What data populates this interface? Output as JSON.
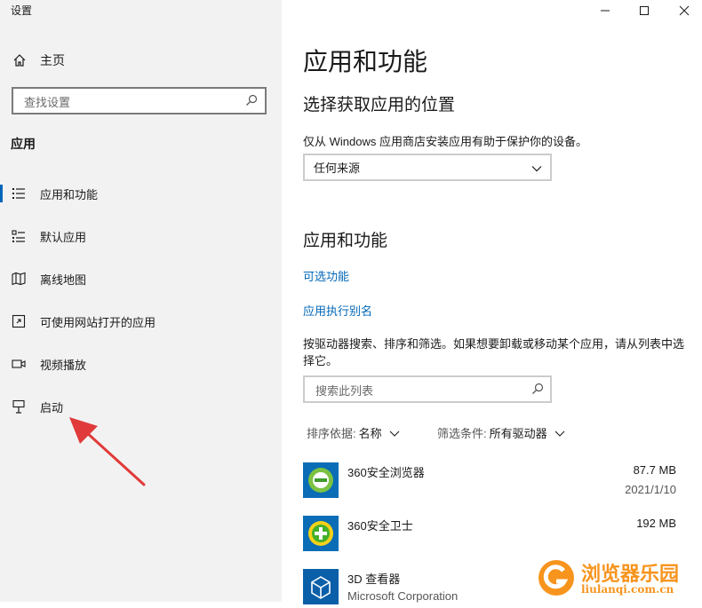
{
  "window": {
    "title": "设置",
    "controls": {
      "minimize": "–",
      "maximize": "□",
      "close": "✕"
    }
  },
  "sidebar": {
    "home_label": "主页",
    "search_placeholder": "查找设置",
    "section": "应用",
    "items": [
      {
        "label": "应用和功能",
        "icon": "apps-features-icon",
        "active": true
      },
      {
        "label": "默认应用",
        "icon": "default-apps-icon"
      },
      {
        "label": "离线地图",
        "icon": "offline-maps-icon"
      },
      {
        "label": "可使用网站打开的应用",
        "icon": "apps-for-websites-icon"
      },
      {
        "label": "视频播放",
        "icon": "video-playback-icon"
      },
      {
        "label": "启动",
        "icon": "startup-icon"
      }
    ]
  },
  "main": {
    "title": "应用和功能",
    "install_section": {
      "heading": "选择获取应用的位置",
      "description": "仅从 Windows 应用商店安装应用有助于保护你的设备。",
      "source_value": "任何来源"
    },
    "apps_section": {
      "heading": "应用和功能",
      "links": [
        "可选功能",
        "应用执行别名"
      ],
      "instructions": "按驱动器搜索、排序和筛选。如果想要卸载或移动某个应用，请从列表中选择它。",
      "search_placeholder": "搜索此列表",
      "sort": {
        "label": "排序依据:",
        "value": "名称"
      },
      "filter": {
        "label": "筛选条件:",
        "value": "所有驱动器"
      },
      "apps": [
        {
          "name": "360安全浏览器",
          "publisher": "",
          "size": "87.7 MB",
          "date": "2021/1/10",
          "icon": "360-browser-icon"
        },
        {
          "name": "360安全卫士",
          "publisher": "",
          "size": "192 MB",
          "date": "",
          "icon": "360-safe-icon"
        },
        {
          "name": "3D 查看器",
          "publisher": "Microsoft Corporation",
          "size": "",
          "date": "",
          "icon": "3d-viewer-icon"
        }
      ]
    }
  },
  "watermark": {
    "name": "浏览器乐园",
    "url": "liulanqi.com.cn"
  },
  "colors": {
    "accent": "#0067b8",
    "sidebar_bg": "#f2f2f2",
    "arrow": "#e03a3a"
  }
}
